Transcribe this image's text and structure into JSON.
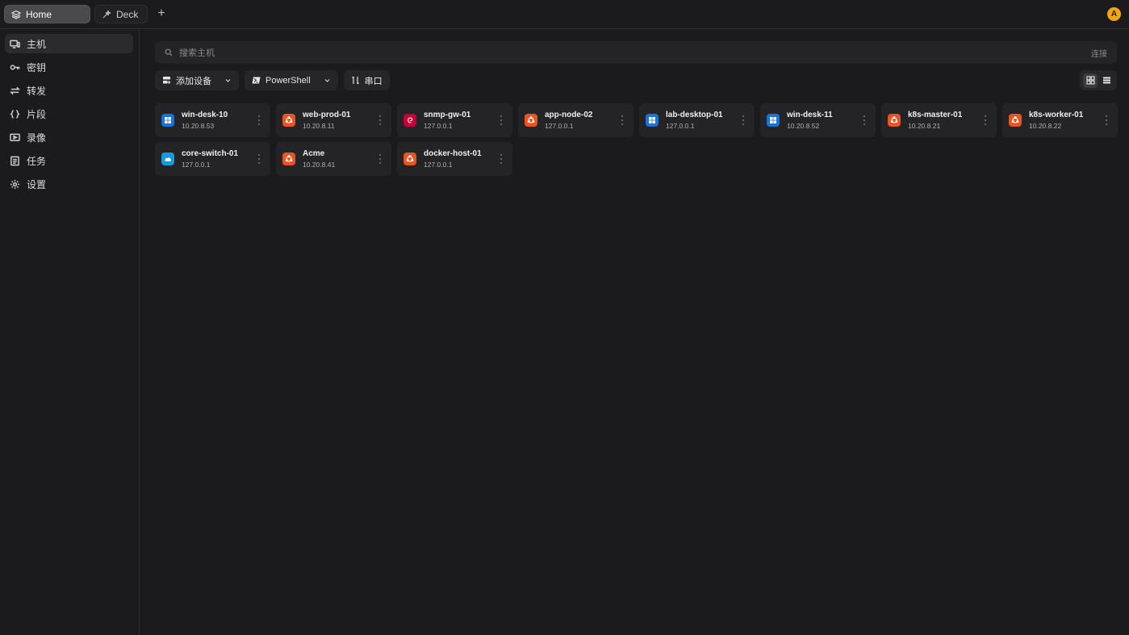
{
  "tabs": [
    {
      "label": "Home",
      "icon": "layers-icon",
      "active": true
    },
    {
      "label": "Deck",
      "icon": "deck-icon",
      "active": false
    }
  ],
  "user": {
    "avatar_letter": "A",
    "avatar_color": "#f2a516"
  },
  "sidebar": {
    "items": [
      {
        "label": "主机",
        "icon": "hosts-icon",
        "active": true
      },
      {
        "label": "密钥",
        "icon": "key-icon",
        "active": false
      },
      {
        "label": "转发",
        "icon": "forward-icon",
        "active": false
      },
      {
        "label": "片段",
        "icon": "braces-icon",
        "active": false
      },
      {
        "label": "录像",
        "icon": "recording-icon",
        "active": false
      },
      {
        "label": "任务",
        "icon": "tasks-icon",
        "active": false
      },
      {
        "label": "设置",
        "icon": "gear-icon",
        "active": false
      }
    ]
  },
  "search": {
    "placeholder": "搜索主机",
    "connect_label": "连接"
  },
  "toolbar": {
    "add_device_label": "添加设备",
    "powershell_label": "PowerShell",
    "serial_label": "串口"
  },
  "view": {
    "mode": "grid"
  },
  "colors": {
    "windows": "#1a73d9",
    "ubuntu": "#e95420",
    "debian": "#c70036",
    "cloud": "#1a9ad9"
  },
  "hosts": [
    {
      "name": "win-desk-10",
      "address": "10.20.8.53",
      "os": "windows"
    },
    {
      "name": "web-prod-01",
      "address": "10.20.8.11",
      "os": "ubuntu"
    },
    {
      "name": "snmp-gw-01",
      "address": "127.0.0.1",
      "os": "debian"
    },
    {
      "name": "app-node-02",
      "address": "127.0.0.1",
      "os": "ubuntu"
    },
    {
      "name": "lab-desktop-01",
      "address": "127.0.0.1",
      "os": "windows"
    },
    {
      "name": "win-desk-11",
      "address": "10.20.8.52",
      "os": "windows"
    },
    {
      "name": "k8s-master-01",
      "address": "10.20.8.21",
      "os": "ubuntu"
    },
    {
      "name": "k8s-worker-01",
      "address": "10.20.8.22",
      "os": "ubuntu"
    },
    {
      "name": "core-switch-01",
      "address": "127.0.0.1",
      "os": "cloud"
    },
    {
      "name": "Acme",
      "address": "10.20.8.41",
      "os": "ubuntu"
    },
    {
      "name": "docker-host-01",
      "address": "127.0.0.1",
      "os": "ubuntu"
    }
  ]
}
